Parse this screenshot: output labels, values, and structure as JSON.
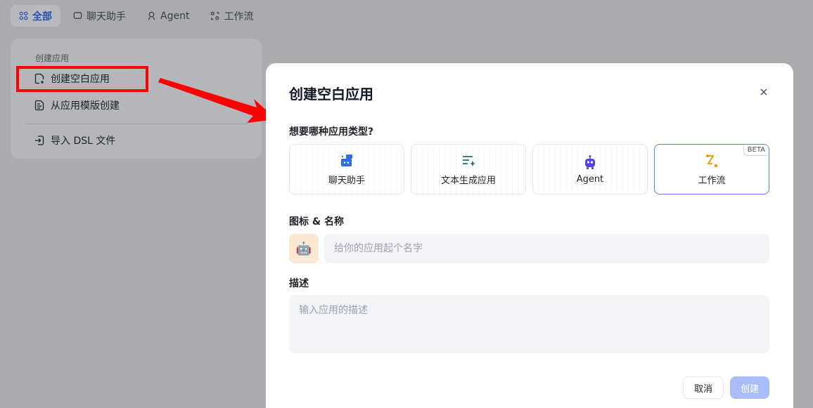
{
  "tabs": [
    {
      "label": "全部",
      "icon": "grid-icon",
      "active": true
    },
    {
      "label": "聊天助手",
      "icon": "chat-icon",
      "active": false
    },
    {
      "label": "Agent",
      "icon": "agent-icon",
      "active": false
    },
    {
      "label": "工作流",
      "icon": "workflow-icon",
      "active": false
    }
  ],
  "menu": {
    "title": "创建应用",
    "items": [
      {
        "label": "创建空白应用",
        "icon": "file-plus-icon"
      },
      {
        "label": "从应用模版创建",
        "icon": "template-icon"
      },
      {
        "label": "导入 DSL 文件",
        "icon": "import-icon"
      }
    ]
  },
  "modal": {
    "title": "创建空白应用",
    "type_question": "想要哪种应用类型?",
    "types": [
      {
        "label": "聊天助手",
        "icon": "chat-bot-icon",
        "selected": false
      },
      {
        "label": "文本生成应用",
        "icon": "text-generate-icon",
        "selected": false
      },
      {
        "label": "Agent",
        "icon": "robot-icon",
        "selected": false
      },
      {
        "label": "工作流",
        "icon": "workflow-icon",
        "selected": true,
        "badge": "BETA"
      }
    ],
    "icon_name_label": "图标 & 名称",
    "app_icon": "🤖",
    "name_placeholder": "给你的应用起个名字",
    "desc_label": "描述",
    "desc_placeholder": "输入应用的描述",
    "cancel_label": "取消",
    "create_label": "创建"
  },
  "colors": {
    "accent": "#2b4fb0",
    "highlight": "#ff0000",
    "create_button": "#a8bdf5",
    "icon_bg": "#fbe8d3"
  }
}
